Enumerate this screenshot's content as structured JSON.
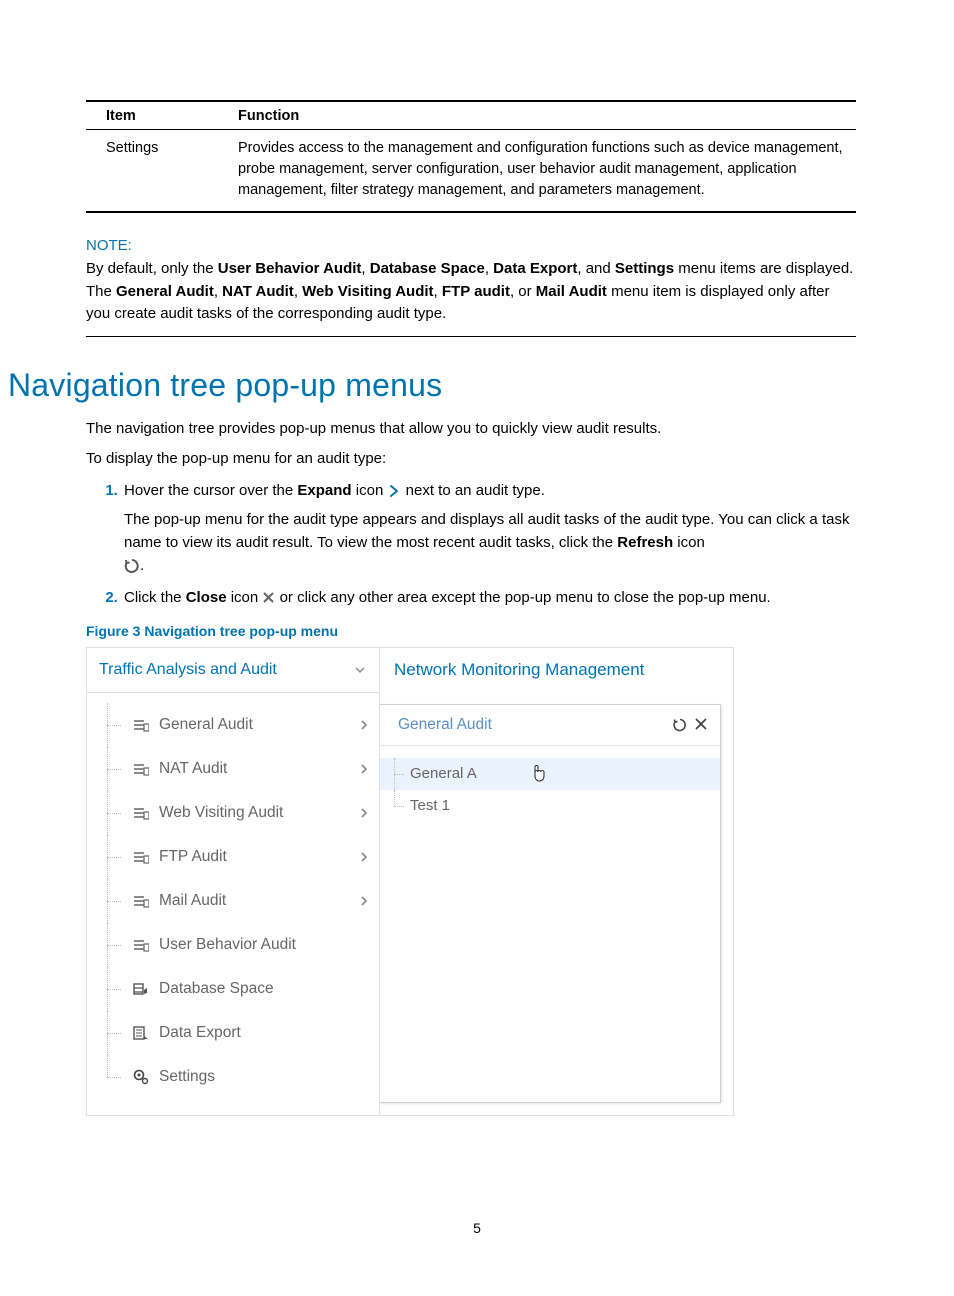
{
  "table": {
    "headers": {
      "item": "Item",
      "function": "Function"
    },
    "rows": [
      {
        "item": "Settings",
        "function": "Provides access to the management and configuration functions such as device management, probe management, server configuration, user behavior audit management, application management, filter strategy management, and parameters management."
      }
    ]
  },
  "note": {
    "label": "NOTE:",
    "text_parts": [
      "By default, only the ",
      "User Behavior Audit",
      ", ",
      "Database Space",
      ", ",
      "Data Export",
      ", and ",
      "Settings",
      " menu items are displayed. The ",
      "General Audit",
      ", ",
      "NAT Audit",
      ", ",
      "Web Visiting Audit",
      ", ",
      "FTP audit",
      ", or ",
      "Mail Audit",
      " menu item is displayed only after you create audit tasks of the corresponding audit type."
    ]
  },
  "heading": "Navigation tree pop-up menus",
  "intro1": "The navigation tree provides pop-up menus that allow you to quickly view audit results.",
  "intro2": "To display the pop-up menu for an audit type:",
  "step1": {
    "pre": "Hover the cursor over the ",
    "bold": "Expand",
    "mid": " icon ",
    "post": " next to an audit type.",
    "sub_pre": "The pop-up menu for the audit type appears and displays all audit tasks of the audit type. You can click a task name to view its audit result. To view the most recent audit tasks, click the ",
    "sub_bold": "Refresh",
    "sub_mid": " icon ",
    "sub_post": "."
  },
  "step2": {
    "pre": "Click the ",
    "bold": "Close",
    "mid": " icon ",
    "post": " or click any other area except the pop-up menu to close the pop-up menu."
  },
  "figure": {
    "caption": "Figure 3 Navigation tree pop-up menu",
    "left_header": "Traffic Analysis and Audit",
    "tree_items": [
      {
        "label": "General Audit",
        "expandable": true
      },
      {
        "label": "NAT Audit",
        "expandable": true
      },
      {
        "label": "Web Visiting Audit",
        "expandable": true
      },
      {
        "label": "FTP Audit",
        "expandable": true
      },
      {
        "label": "Mail Audit",
        "expandable": true
      },
      {
        "label": "User Behavior Audit",
        "expandable": false
      },
      {
        "label": "Database Space",
        "expandable": false
      },
      {
        "label": "Data Export",
        "expandable": false
      },
      {
        "label": "Settings",
        "expandable": false
      }
    ],
    "right_header": "Network Monitoring Management",
    "panel_title": "General Audit",
    "panel_items": [
      "General A",
      "Test 1"
    ]
  },
  "page_number": "5"
}
